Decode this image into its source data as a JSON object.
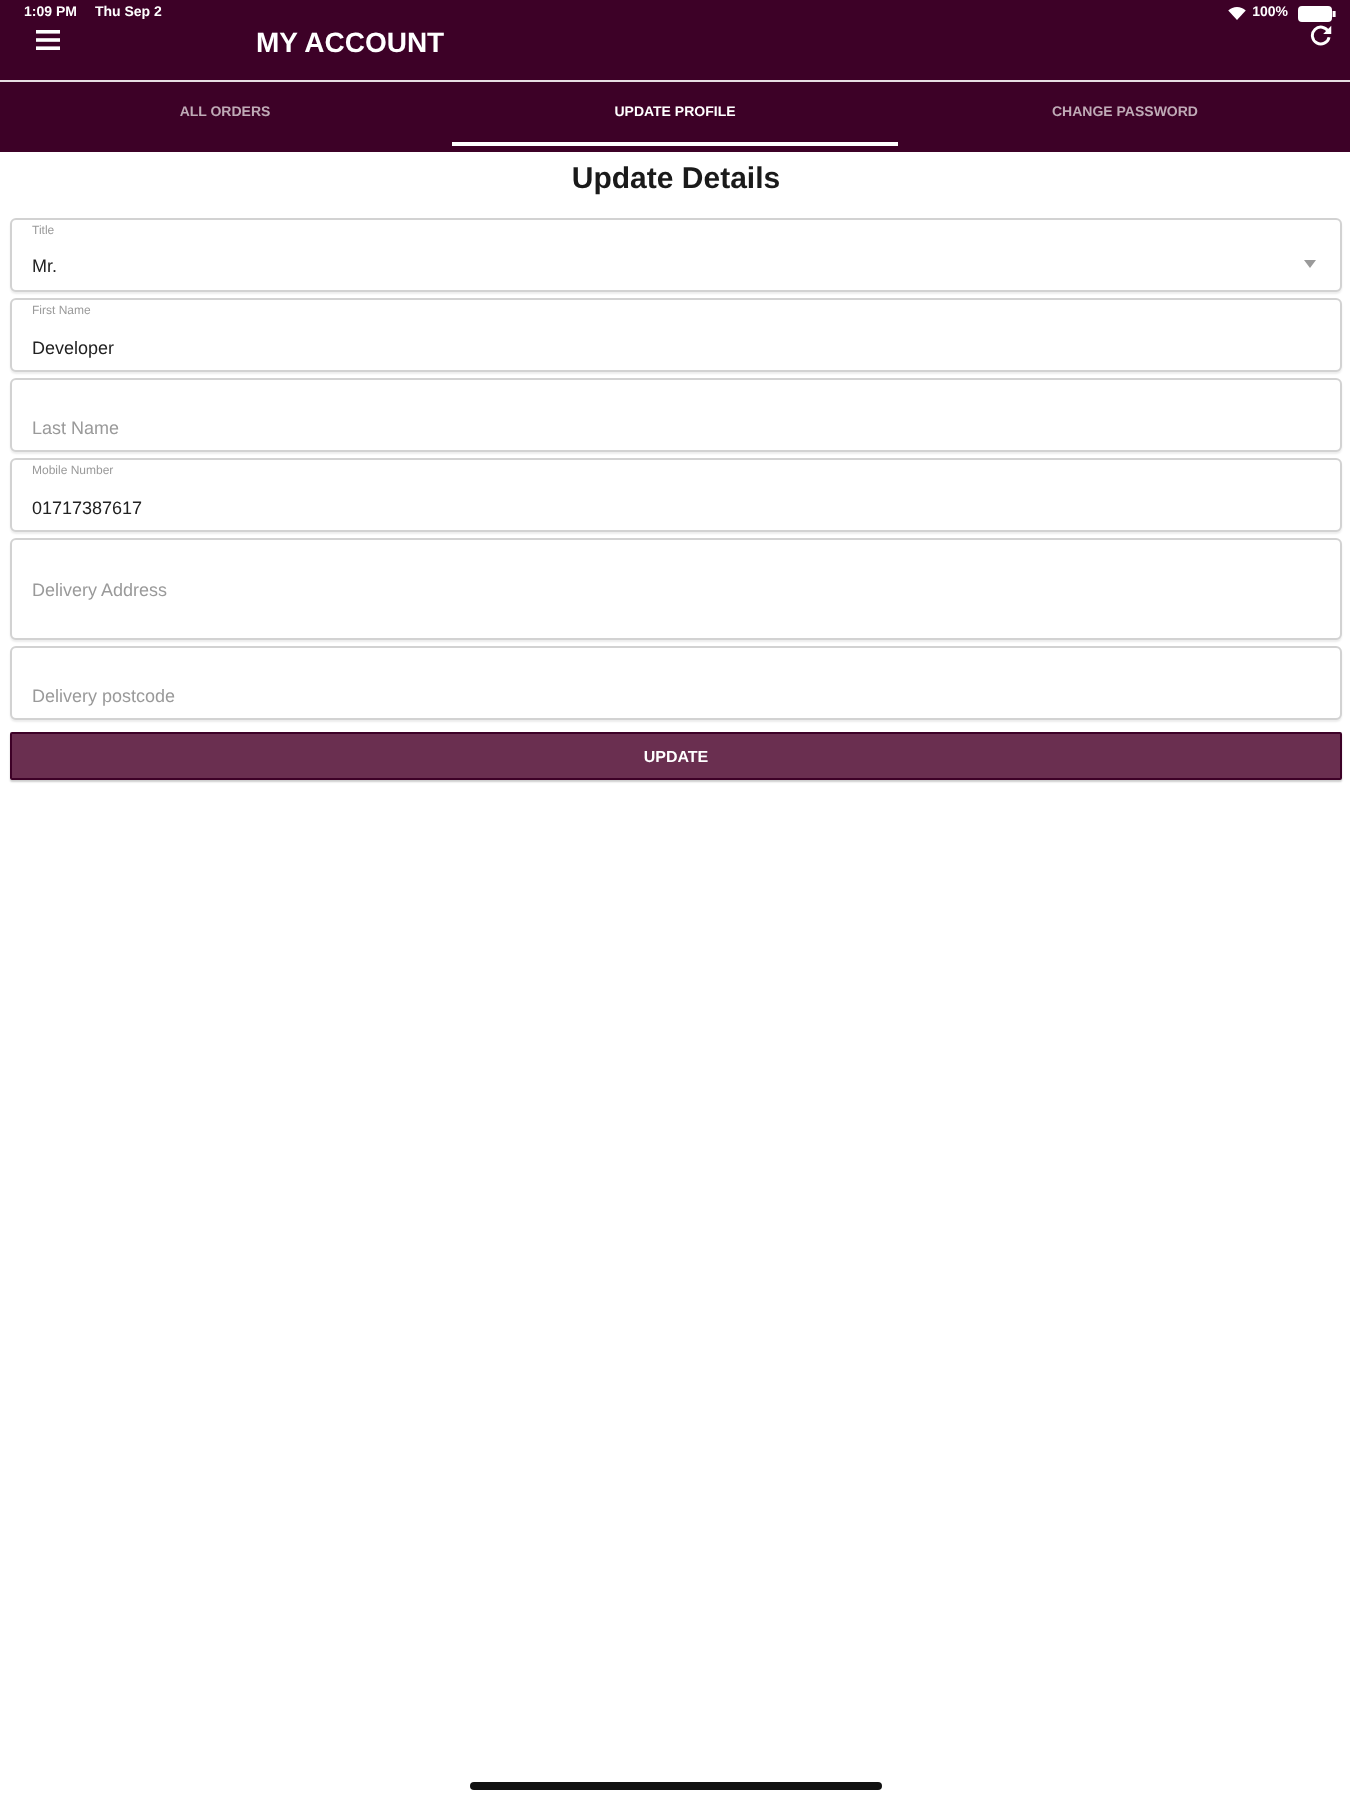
{
  "status_bar": {
    "time": "1:09 PM",
    "date": "Thu Sep 2",
    "battery": "100%"
  },
  "header": {
    "title": "MY ACCOUNT"
  },
  "tabs": [
    {
      "label": "ALL ORDERS",
      "selected": false
    },
    {
      "label": "UPDATE PROFILE",
      "selected": true
    },
    {
      "label": "CHANGE PASSWORD",
      "selected": false
    }
  ],
  "form": {
    "heading": "Update Details",
    "fields": [
      {
        "kind": "select",
        "label": "Title",
        "value": "Mr."
      },
      {
        "kind": "text",
        "label": "First Name",
        "value": "Developer"
      },
      {
        "kind": "text",
        "placeholder": "Last Name"
      },
      {
        "kind": "text",
        "label": "Mobile Number",
        "value": "01717387617"
      },
      {
        "kind": "textarea",
        "placeholder": "Delivery Address"
      },
      {
        "kind": "text",
        "placeholder": "Delivery postcode"
      }
    ],
    "submit": "UPDATE"
  }
}
